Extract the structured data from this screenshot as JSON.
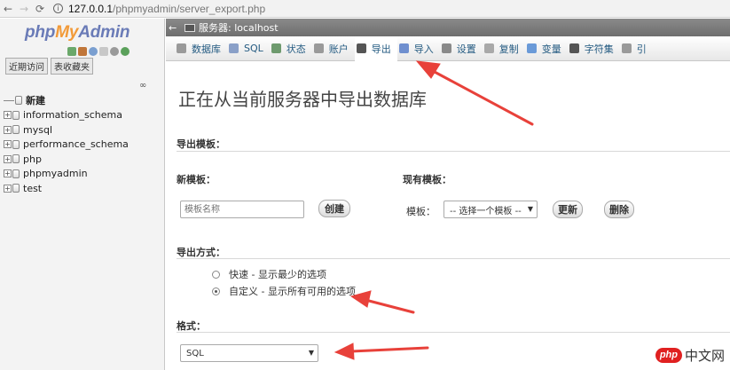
{
  "browser": {
    "url_host": "127.0.0.1",
    "url_path": "/phpmyadmin/server_export.php"
  },
  "sidebar": {
    "logo": {
      "php": "php",
      "my": "My",
      "admin": "Admin"
    },
    "quick_icons": [
      "home-icon",
      "logout-icon",
      "help-icon",
      "docs-icon",
      "settings-icon",
      "reload-icon"
    ],
    "tabs": [
      "近期访问",
      "表收藏夹"
    ],
    "tree": [
      {
        "label": "新建",
        "type": "new"
      },
      {
        "label": "information_schema",
        "type": "db"
      },
      {
        "label": "mysql",
        "type": "db"
      },
      {
        "label": "performance_schema",
        "type": "db"
      },
      {
        "label": "php",
        "type": "db"
      },
      {
        "label": "phpmyadmin",
        "type": "db"
      },
      {
        "label": "test",
        "type": "db"
      }
    ]
  },
  "server_bar": {
    "label": "服务器: localhost"
  },
  "menubar": {
    "tabs": [
      {
        "label": "数据库",
        "icon": "database-icon",
        "color": "#9a9a9a"
      },
      {
        "label": "SQL",
        "icon": "sql-icon",
        "color": "#8aa0c8"
      },
      {
        "label": "状态",
        "icon": "status-icon",
        "color": "#6e9a6e"
      },
      {
        "label": "账户",
        "icon": "users-icon",
        "color": "#9a9a9a"
      },
      {
        "label": "导出",
        "icon": "export-icon",
        "color": "#555555"
      },
      {
        "label": "导入",
        "icon": "import-icon",
        "color": "#6f8fcf"
      },
      {
        "label": "设置",
        "icon": "wrench-icon",
        "color": "#8a8a8a"
      },
      {
        "label": "复制",
        "icon": "replication-icon",
        "color": "#a9a9a9"
      },
      {
        "label": "变量",
        "icon": "variables-icon",
        "color": "#6a9ad8"
      },
      {
        "label": "字符集",
        "icon": "charset-icon",
        "color": "#555555"
      },
      {
        "label": "引",
        "icon": "engines-icon",
        "color": "#9a9a9a"
      }
    ],
    "active_index": 4
  },
  "main": {
    "title": "正在从当前服务器中导出数据库",
    "export_templates": {
      "heading": "导出模板：",
      "new_template_label": "新模板：",
      "name_placeholder": "模板名称",
      "create_button": "创建",
      "existing_template_label": "现有模板：",
      "template_label": "模板：",
      "template_select": "-- 选择一个模板 --",
      "update_button": "更新",
      "delete_button": "删除"
    },
    "export_method": {
      "heading": "导出方式：",
      "options": [
        {
          "label": "快速 - 显示最少的选项",
          "checked": false
        },
        {
          "label": "自定义 - 显示所有可用的选项",
          "checked": true
        }
      ]
    },
    "format": {
      "heading": "格式：",
      "value": "SQL"
    }
  },
  "watermark": {
    "badge": "php",
    "text": "中文网"
  },
  "colors": {
    "annotation_arrow": "#e8413a"
  }
}
